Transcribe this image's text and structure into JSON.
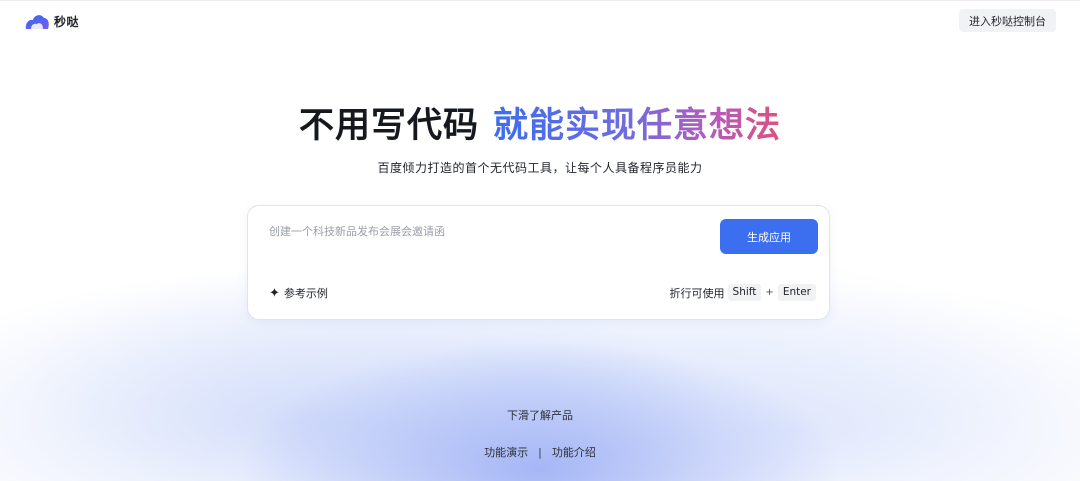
{
  "header": {
    "brand_name": "秒哒",
    "console_button": "进入秒哒控制台"
  },
  "hero": {
    "title_part1": "不用写代码",
    "title_part2": "就能实现任意想法",
    "subtitle": "百度倾力打造的首个无代码工具，让每个人具备程序员能力"
  },
  "composer": {
    "placeholder": "创建一个科技新品发布会展会邀请函",
    "value": "",
    "generate_button": "生成应用",
    "examples_label": "参考示例",
    "shortcut_hint": "折行可使用",
    "shortcut_key1": "Shift",
    "shortcut_plus": "+",
    "shortcut_key2": "Enter"
  },
  "footer": {
    "scroll_hint": "下滑了解产品",
    "link_demo": "功能演示",
    "separator": "|",
    "link_intro": "功能介绍"
  },
  "colors": {
    "accent": "#3b6ff0",
    "title_gradient": [
      "#3d6df0",
      "#6d6ce0",
      "#b25cc0",
      "#e0507e"
    ]
  },
  "icons": {
    "logo": "cloud-logo-icon",
    "examples": "sparkle-icon"
  }
}
